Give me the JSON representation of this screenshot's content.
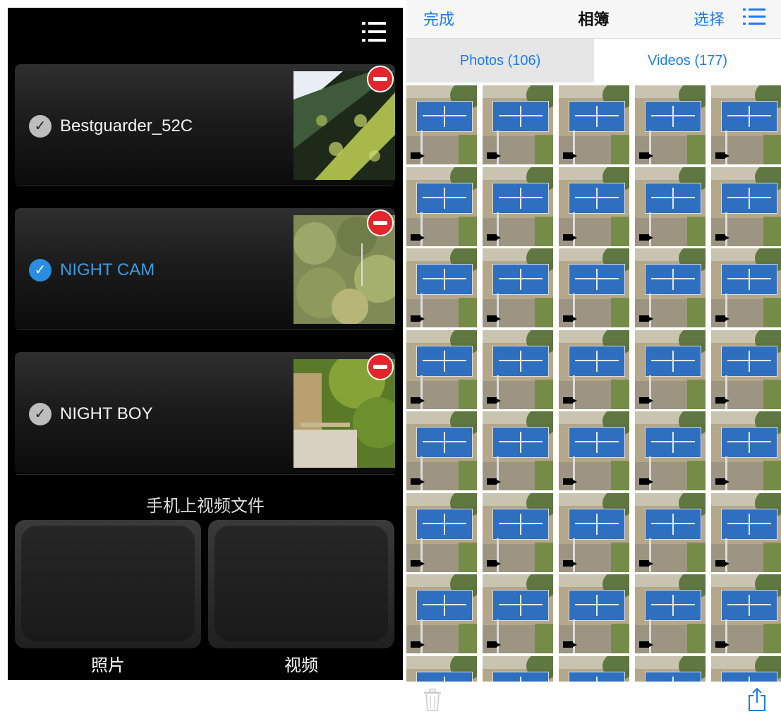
{
  "left": {
    "cameras": [
      {
        "name": "Bestguarder_52C",
        "selected": false
      },
      {
        "name": "NIGHT CAM",
        "selected": true
      },
      {
        "name": "NIGHT BOY",
        "selected": false
      }
    ],
    "section_title": "手机上视频文件",
    "tiles": [
      {
        "label": "照片"
      },
      {
        "label": "视频"
      }
    ]
  },
  "right": {
    "nav": {
      "done_label": "完成",
      "title": "相簿",
      "select_label": "选择"
    },
    "segments": [
      {
        "label": "Photos (106)",
        "active": true
      },
      {
        "label": "Videos (177)",
        "active": false
      }
    ]
  },
  "colors": {
    "accent_blue": "#1a7cf5",
    "selected_blue": "#3a9be3",
    "delete_red": "#e2262b"
  },
  "icons": [
    "menu-icon",
    "check-icon",
    "delete-icon",
    "list-icon",
    "video-camera-icon",
    "trash-icon",
    "share-icon"
  ]
}
